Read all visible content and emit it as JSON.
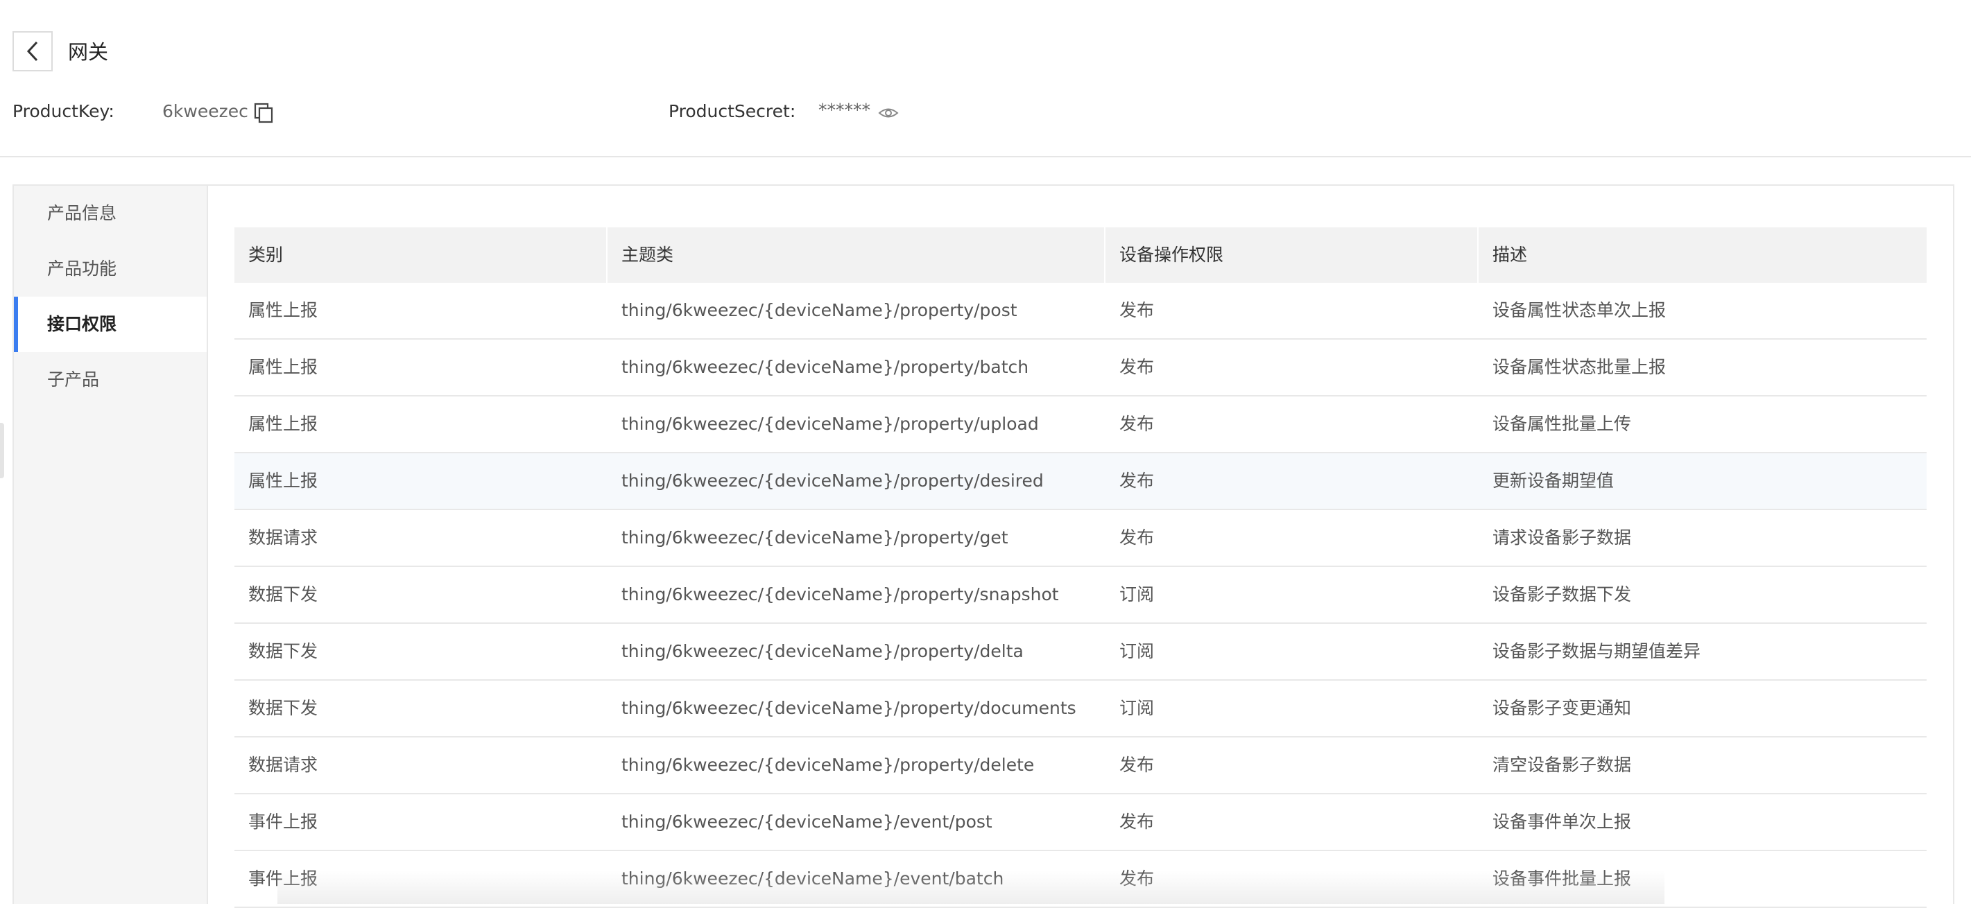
{
  "header": {
    "title": "网关",
    "product_key_label": "ProductKey:",
    "product_key_value": "6kweezec",
    "product_secret_label": "ProductSecret:",
    "product_secret_value": "******",
    "icons": [
      "back-chevron-icon",
      "copy-icon",
      "eye-icon"
    ]
  },
  "sidebar": {
    "items": [
      {
        "label": "产品信息",
        "active": false
      },
      {
        "label": "产品功能",
        "active": false
      },
      {
        "label": "接口权限",
        "active": true
      },
      {
        "label": "子产品",
        "active": false
      }
    ]
  },
  "table": {
    "columns": [
      "类别",
      "主题类",
      "设备操作权限",
      "描述"
    ],
    "rows": [
      {
        "category": "属性上报",
        "topic": "thing/6kweezec/{deviceName}/property/post",
        "permission": "发布",
        "description": "设备属性状态单次上报"
      },
      {
        "category": "属性上报",
        "topic": "thing/6kweezec/{deviceName}/property/batch",
        "permission": "发布",
        "description": "设备属性状态批量上报"
      },
      {
        "category": "属性上报",
        "topic": "thing/6kweezec/{deviceName}/property/upload",
        "permission": "发布",
        "description": "设备属性批量上传"
      },
      {
        "category": "属性上报",
        "topic": "thing/6kweezec/{deviceName}/property/desired",
        "permission": "发布",
        "description": "更新设备期望值"
      },
      {
        "category": "数据请求",
        "topic": "thing/6kweezec/{deviceName}/property/get",
        "permission": "发布",
        "description": "请求设备影子数据"
      },
      {
        "category": "数据下发",
        "topic": "thing/6kweezec/{deviceName}/property/snapshot",
        "permission": "订阅",
        "description": "设备影子数据下发"
      },
      {
        "category": "数据下发",
        "topic": "thing/6kweezec/{deviceName}/property/delta",
        "permission": "订阅",
        "description": "设备影子数据与期望值差异"
      },
      {
        "category": "数据下发",
        "topic": "thing/6kweezec/{deviceName}/property/documents",
        "permission": "订阅",
        "description": "设备影子变更通知"
      },
      {
        "category": "数据请求",
        "topic": "thing/6kweezec/{deviceName}/property/delete",
        "permission": "发布",
        "description": "清空设备影子数据"
      },
      {
        "category": "事件上报",
        "topic": "thing/6kweezec/{deviceName}/event/post",
        "permission": "发布",
        "description": "设备事件单次上报"
      },
      {
        "category": "事件上报",
        "topic": "thing/6kweezec/{deviceName}/event/batch",
        "permission": "发布",
        "description": "设备事件批量上报"
      }
    ]
  },
  "colors": {
    "accent": "#3b7df0",
    "sidebar_bg": "#f5f5f5",
    "table_header_bg": "#f2f2f2",
    "row_highlight_bg": "#f6f9fc"
  }
}
